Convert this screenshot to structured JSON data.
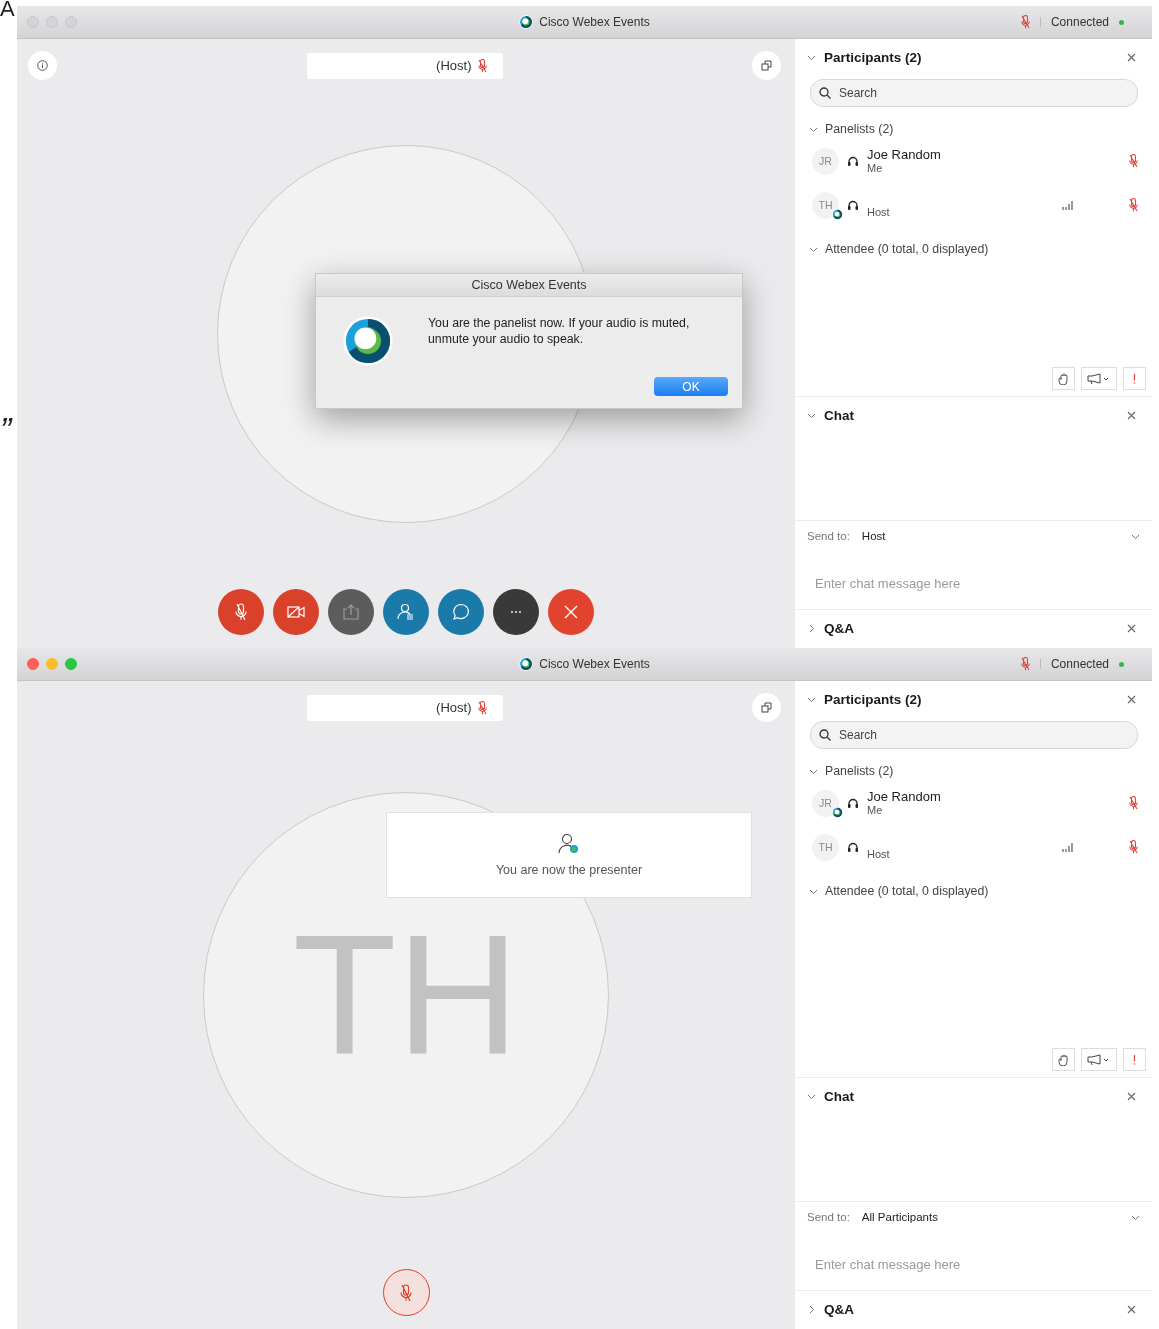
{
  "backdrop": {
    "texts": [
      "A",
      "”"
    ]
  },
  "windows": [
    {
      "title": "Cisco Webex Events",
      "focused": false,
      "audio_muted": true,
      "status": "Connected",
      "stage": {
        "info_button": true,
        "name_tag": "(Host)",
        "name_muted": true,
        "dialog": {
          "title": "Cisco Webex Events",
          "message": "You are the panelist now. If your audio is muted, unmute your audio to speak.",
          "button": "OK"
        },
        "controls": [
          {
            "kind": "mute"
          },
          {
            "kind": "video"
          },
          {
            "kind": "share"
          },
          {
            "kind": "participants"
          },
          {
            "kind": "chat"
          },
          {
            "kind": "more"
          },
          {
            "kind": "leave"
          }
        ]
      },
      "panel": {
        "participants": {
          "title": "Participants (2)",
          "expanded": true,
          "search_placeholder": "Search",
          "groups": [
            {
              "label": "Panelists (2)",
              "expanded": true,
              "members": [
                {
                  "initials": "JR",
                  "name": "Joe Random",
                  "role": "Me",
                  "presenter": false,
                  "speaking": false,
                  "muted": true
                },
                {
                  "initials": "TH",
                  "role": "Host",
                  "presenter": true,
                  "speaking": true,
                  "muted": true
                }
              ]
            },
            {
              "label": "Attendee (0 total, 0 displayed)",
              "expanded": true
            }
          ]
        },
        "chat": {
          "title": "Chat",
          "expanded": true,
          "send_to_label": "Send to:",
          "send_to": "Host",
          "placeholder": "Enter chat message here"
        },
        "qa": {
          "title": "Q&A",
          "expanded": false
        }
      }
    },
    {
      "title": "Cisco Webex Events",
      "focused": true,
      "audio_muted": true,
      "status": "Connected",
      "stage": {
        "info_button": false,
        "name_tag": "(Host)",
        "name_muted": true,
        "avatar_initials": "TH",
        "toast": {
          "message": "You are now the presenter"
        },
        "controls": [
          {
            "kind": "mute-outline"
          }
        ]
      },
      "panel": {
        "participants": {
          "title": "Participants (2)",
          "expanded": true,
          "search_placeholder": "Search",
          "groups": [
            {
              "label": "Panelists (2)",
              "expanded": true,
              "members": [
                {
                  "initials": "JR",
                  "name": "Joe Random",
                  "role": "Me",
                  "presenter": true,
                  "speaking": false,
                  "muted": true
                },
                {
                  "initials": "TH",
                  "role": "Host",
                  "presenter": false,
                  "speaking": true,
                  "muted": true
                }
              ]
            },
            {
              "label": "Attendee (0 total, 0 displayed)",
              "expanded": true
            }
          ]
        },
        "chat": {
          "title": "Chat",
          "expanded": true,
          "send_to_label": "Send to:",
          "send_to": "All Participants",
          "placeholder": "Enter chat message here"
        },
        "qa": {
          "title": "Q&A",
          "expanded": false
        }
      }
    }
  ]
}
